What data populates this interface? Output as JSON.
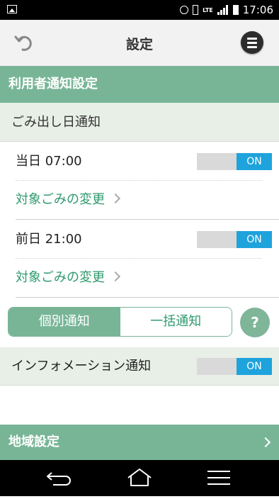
{
  "status_bar": {
    "network": "LTE",
    "time": "17:06"
  },
  "header": {
    "title": "設定"
  },
  "section_user_notifications": {
    "title": "利用者通知設定"
  },
  "garbage_day": {
    "title": "ごみ出し日通知",
    "items": [
      {
        "label": "当日 07:00",
        "toggle": "ON",
        "link": "対象ごみの変更"
      },
      {
        "label": "前日 21:00",
        "toggle": "ON",
        "link": "対象ごみの変更"
      }
    ]
  },
  "mode_tabs": {
    "individual": "個別通知",
    "bulk": "一括通知",
    "selected": "個別通知",
    "help": "?"
  },
  "information": {
    "label": "インフォメーション通知",
    "toggle": "ON"
  },
  "region": {
    "title": "地域設定"
  },
  "colors": {
    "accent_green": "#78b597",
    "toggle_on": "#1ea3dc",
    "link_green": "#2f9a6e"
  }
}
